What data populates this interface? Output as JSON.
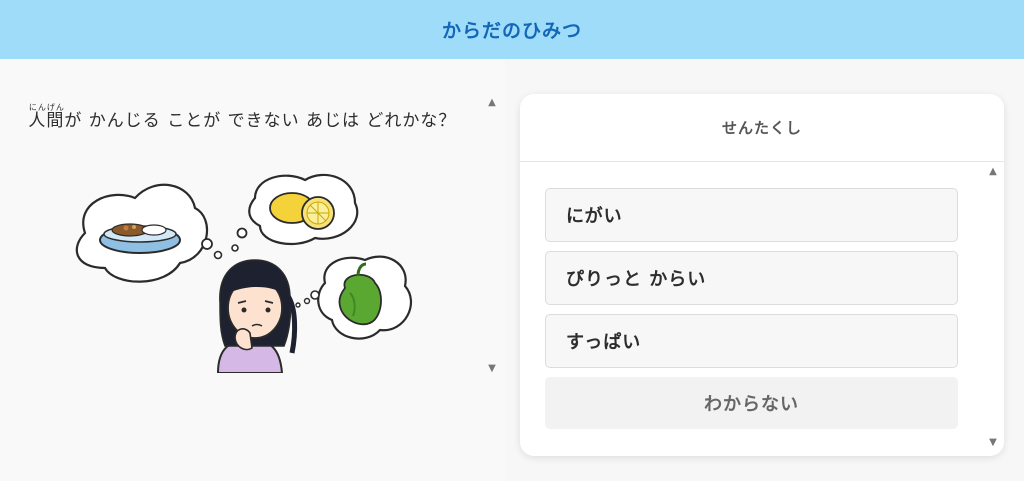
{
  "header": {
    "title": "からだのひみつ"
  },
  "question": {
    "ruby_base": "人間",
    "ruby_reading": "にんげん",
    "text": "が かんじる ことが できない あじは どれかな？"
  },
  "illustration": {
    "description_icons": [
      "curry-rice-icon",
      "lemon-icon",
      "green-pepper-icon",
      "thinking-girl-icon"
    ]
  },
  "choices": {
    "header": "せんたくし",
    "items": [
      {
        "label": "にがい"
      },
      {
        "label": "ぴりっと からい"
      },
      {
        "label": "すっぱい"
      }
    ],
    "unknown_label": "わからない"
  },
  "colors": {
    "header_bg": "#9edcfa",
    "header_text": "#1466b8"
  }
}
